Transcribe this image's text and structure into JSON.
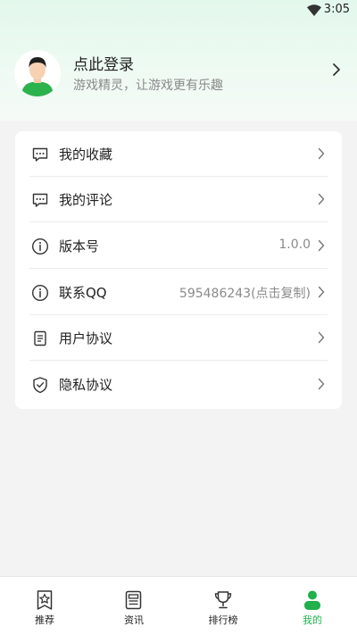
{
  "status_bar": {
    "time": "3:05"
  },
  "profile": {
    "name": "点此登录",
    "subtitle": "游戏精灵，让游戏更有乐趣"
  },
  "menu": {
    "items": [
      {
        "label": "我的收藏",
        "value": "",
        "icon": "comment-bubble-icon"
      },
      {
        "label": "我的评论",
        "value": "",
        "icon": "comment-bubble-icon"
      },
      {
        "label": "版本号",
        "value": "1.0.0",
        "icon": "info-icon"
      },
      {
        "label": "联系QQ",
        "value": "595486243(点击复制)",
        "icon": "info-icon"
      },
      {
        "label": "用户协议",
        "value": "",
        "icon": "document-icon"
      },
      {
        "label": "隐私协议",
        "value": "",
        "icon": "shield-check-icon"
      }
    ]
  },
  "tabs": [
    {
      "label": "推荐",
      "icon": "star-badge-icon",
      "active": false
    },
    {
      "label": "资讯",
      "icon": "newspaper-icon",
      "active": false
    },
    {
      "label": "排行榜",
      "icon": "trophy-icon",
      "active": false
    },
    {
      "label": "我的",
      "icon": "person-icon",
      "active": true
    }
  ],
  "colors": {
    "accent": "#21b04b",
    "header_gradient_top": "#e3f8ec",
    "page_background": "#f3f3f3"
  }
}
